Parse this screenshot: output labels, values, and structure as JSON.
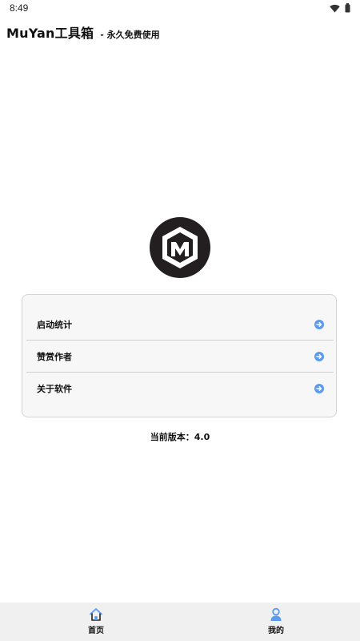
{
  "status_bar": {
    "time": "8:49",
    "icons": [
      "wifi-icon",
      "battery-icon"
    ]
  },
  "header": {
    "title": "MuYan工具箱",
    "subtitle": "- 永久免费使用"
  },
  "logo": {
    "icon": "m-hexagon-logo"
  },
  "menu": {
    "items": [
      {
        "label": "启动统计",
        "icon": "arrow-right-circle-icon"
      },
      {
        "label": "赞赏作者",
        "icon": "arrow-right-circle-icon"
      },
      {
        "label": "关于软件",
        "icon": "arrow-right-circle-icon"
      }
    ]
  },
  "version": "当前版本：4.0",
  "bottom_nav": {
    "items": [
      {
        "label": "首页",
        "icon": "home-icon"
      },
      {
        "label": "我的",
        "icon": "user-icon"
      }
    ]
  },
  "colors": {
    "accent": "#5b9bf0",
    "logo": "#231f20",
    "nav_bg": "#f0f0f0"
  }
}
